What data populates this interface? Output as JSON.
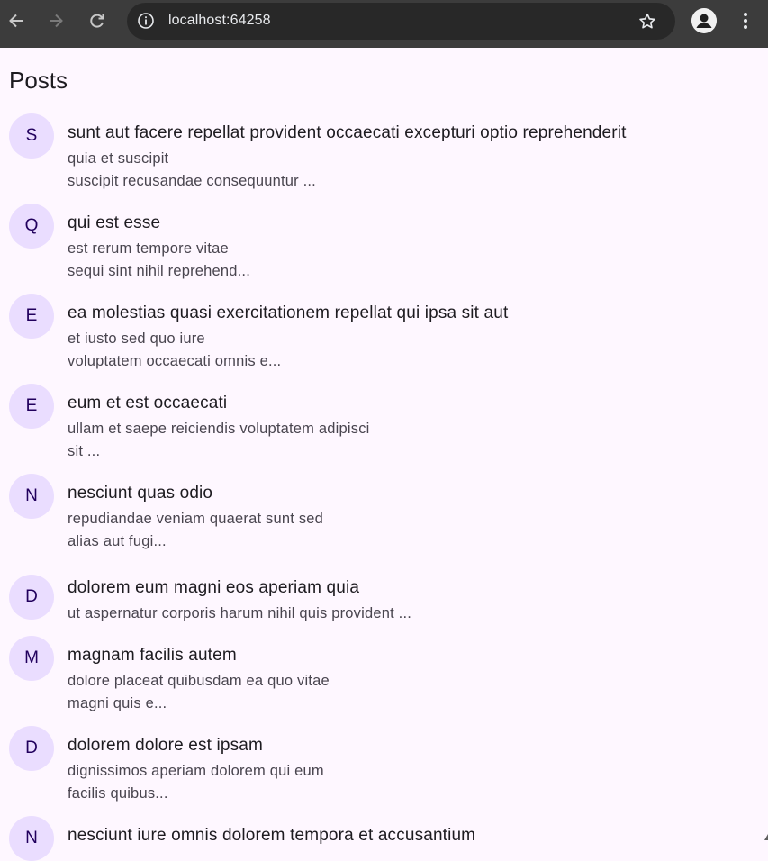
{
  "browser": {
    "url": "localhost:64258"
  },
  "page": {
    "title": "Posts"
  },
  "posts": [
    {
      "initial": "S",
      "title": "sunt aut facere repellat provident occaecati excepturi optio reprehenderit",
      "line1": "quia et suscipit",
      "line2": "suscipit recusandae consequuntur ..."
    },
    {
      "initial": "Q",
      "title": "qui est esse",
      "line1": "est rerum tempore vitae",
      "line2": "sequi sint nihil reprehend..."
    },
    {
      "initial": "E",
      "title": "ea molestias quasi exercitationem repellat qui ipsa sit aut",
      "line1": "et iusto sed quo iure",
      "line2": "voluptatem occaecati omnis e..."
    },
    {
      "initial": "E",
      "title": "eum et est occaecati",
      "line1": "ullam et saepe reiciendis voluptatem adipisci",
      "line2": "sit ..."
    },
    {
      "initial": "N",
      "title": "nesciunt quas odio",
      "line1": "repudiandae veniam quaerat sunt sed",
      "line2": "alias aut fugi..."
    },
    {
      "initial": "D",
      "title": "dolorem eum magni eos aperiam quia",
      "line1": "ut aspernatur corporis harum nihil quis provident ...",
      "line2": ""
    },
    {
      "initial": "M",
      "title": "magnam facilis autem",
      "line1": "dolore placeat quibusdam ea quo vitae",
      "line2": "magni quis e..."
    },
    {
      "initial": "D",
      "title": "dolorem dolore est ipsam",
      "line1": "dignissimos aperiam dolorem qui eum",
      "line2": "facilis quibus..."
    },
    {
      "initial": "N",
      "title": "nesciunt iure omnis dolorem tempora et accusantium",
      "line1": "",
      "line2": ""
    }
  ],
  "colors": {
    "background": "#fef7ff",
    "avatar_bg": "#eaddff",
    "avatar_text": "#21005d",
    "browser_bar": "#3c3c3c"
  }
}
